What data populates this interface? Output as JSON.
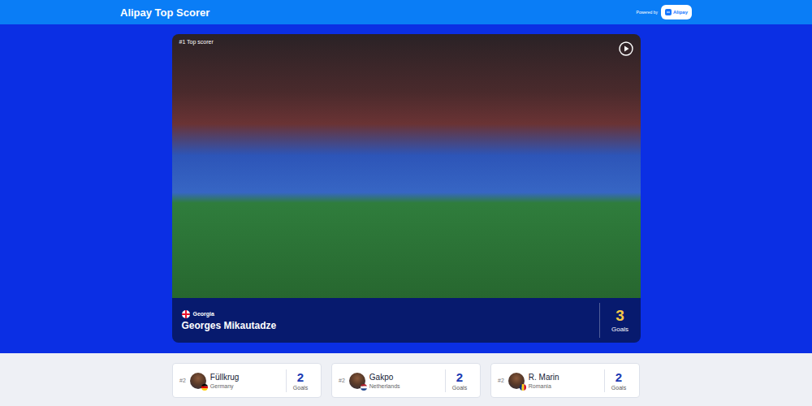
{
  "header": {
    "title": "Alipay Top Scorer",
    "powered_by": "Powered by",
    "partner": "Alipay"
  },
  "leader": {
    "badge": "#1 Top scorer",
    "country": "Georgia",
    "name": "Georges Mikautadze",
    "goals": "3",
    "goals_label": "Goals"
  },
  "runners_up": [
    {
      "rank": "#2",
      "name": "Füllkrug",
      "country": "Germany",
      "goals": "2",
      "goals_label": "Goals",
      "flag_layout": "horizontal",
      "flag_colors": [
        "#000000",
        "#dd0000",
        "#ffce00"
      ]
    },
    {
      "rank": "#2",
      "name": "Gakpo",
      "country": "Netherlands",
      "goals": "2",
      "goals_label": "Goals",
      "flag_layout": "horizontal",
      "flag_colors": [
        "#ae1c28",
        "#ffffff",
        "#21468b"
      ]
    },
    {
      "rank": "#2",
      "name": "R. Marin",
      "country": "Romania",
      "goals": "2",
      "goals_label": "Goals",
      "flag_layout": "vertical",
      "flag_colors": [
        "#002b7f",
        "#fcd116",
        "#ce1126"
      ]
    }
  ]
}
